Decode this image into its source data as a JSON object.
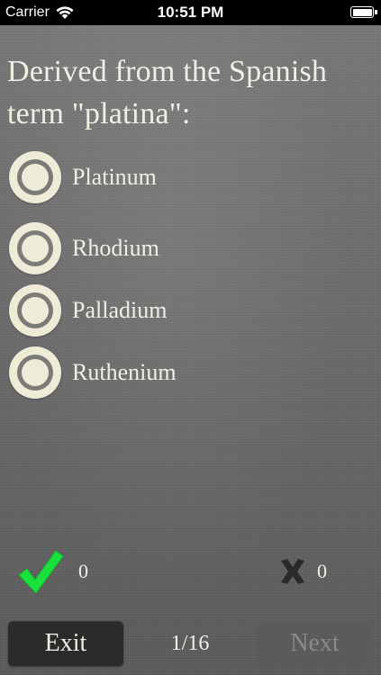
{
  "status_bar": {
    "carrier": "Carrier",
    "time": "10:51 PM"
  },
  "question": {
    "text": "Derived from the Spanish term \"platina\":"
  },
  "answers": [
    {
      "label": "Platinum"
    },
    {
      "label": "Rhodium"
    },
    {
      "label": "Palladium"
    },
    {
      "label": "Ruthenium"
    }
  ],
  "scores": {
    "correct": "0",
    "wrong": "0"
  },
  "footer": {
    "exit_label": "Exit",
    "progress": "1/16",
    "next_label": "Next"
  },
  "colors": {
    "status_bar": "#000000",
    "text": "#f1efe4",
    "radio": "#eeebd6",
    "check": "#19e03a",
    "x_mark": "#2a2a2a",
    "exit_bg": "#2b2b2b",
    "next_bg_disabled": "#5b5b5b"
  },
  "icons": {
    "wifi": "wifi-icon",
    "battery": "battery-icon",
    "radio": "radio-icon",
    "check": "check-icon",
    "x": "x-icon"
  },
  "state": {
    "next_enabled": false
  }
}
